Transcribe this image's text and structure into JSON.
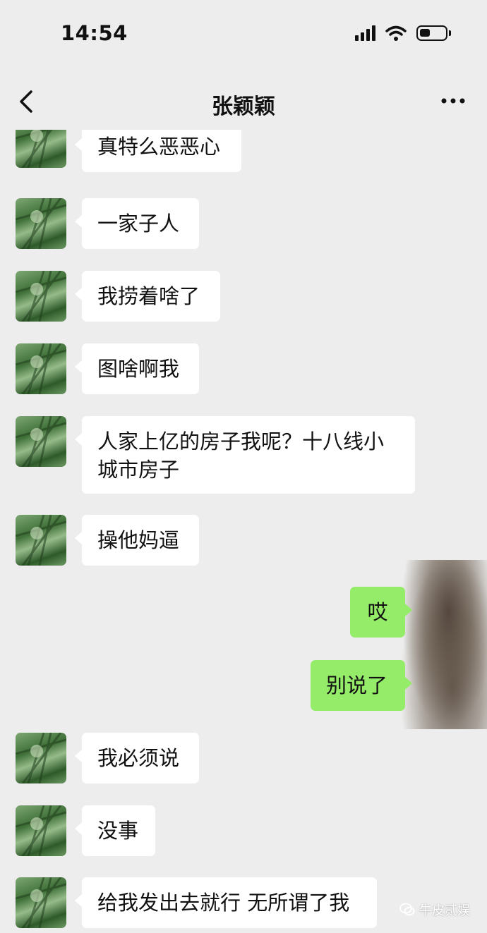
{
  "status_bar": {
    "time": "14:54"
  },
  "nav": {
    "title": "张颖颖"
  },
  "messages": [
    {
      "from": "contact",
      "text": "真特么恶恶心"
    },
    {
      "from": "contact",
      "text": "一家子人"
    },
    {
      "from": "contact",
      "text": "我捞着啥了"
    },
    {
      "from": "contact",
      "text": "图啥啊我"
    },
    {
      "from": "contact",
      "text_line1": "人家上亿的房子我呢？十八线小",
      "text_line2": "城市房子"
    },
    {
      "from": "contact",
      "text": "操他妈逼"
    },
    {
      "from": "me",
      "text": "哎"
    },
    {
      "from": "me",
      "text": "别说了"
    },
    {
      "from": "contact",
      "text": "我必须说"
    },
    {
      "from": "contact",
      "text": "没事"
    },
    {
      "from": "contact",
      "text": "给我发出去就行 无所谓了我"
    }
  ],
  "watermark": {
    "text": "牛皮贰娱"
  },
  "colors": {
    "background": "#ededed",
    "contact_bubble": "#ffffff",
    "my_bubble": "#95ec69"
  }
}
